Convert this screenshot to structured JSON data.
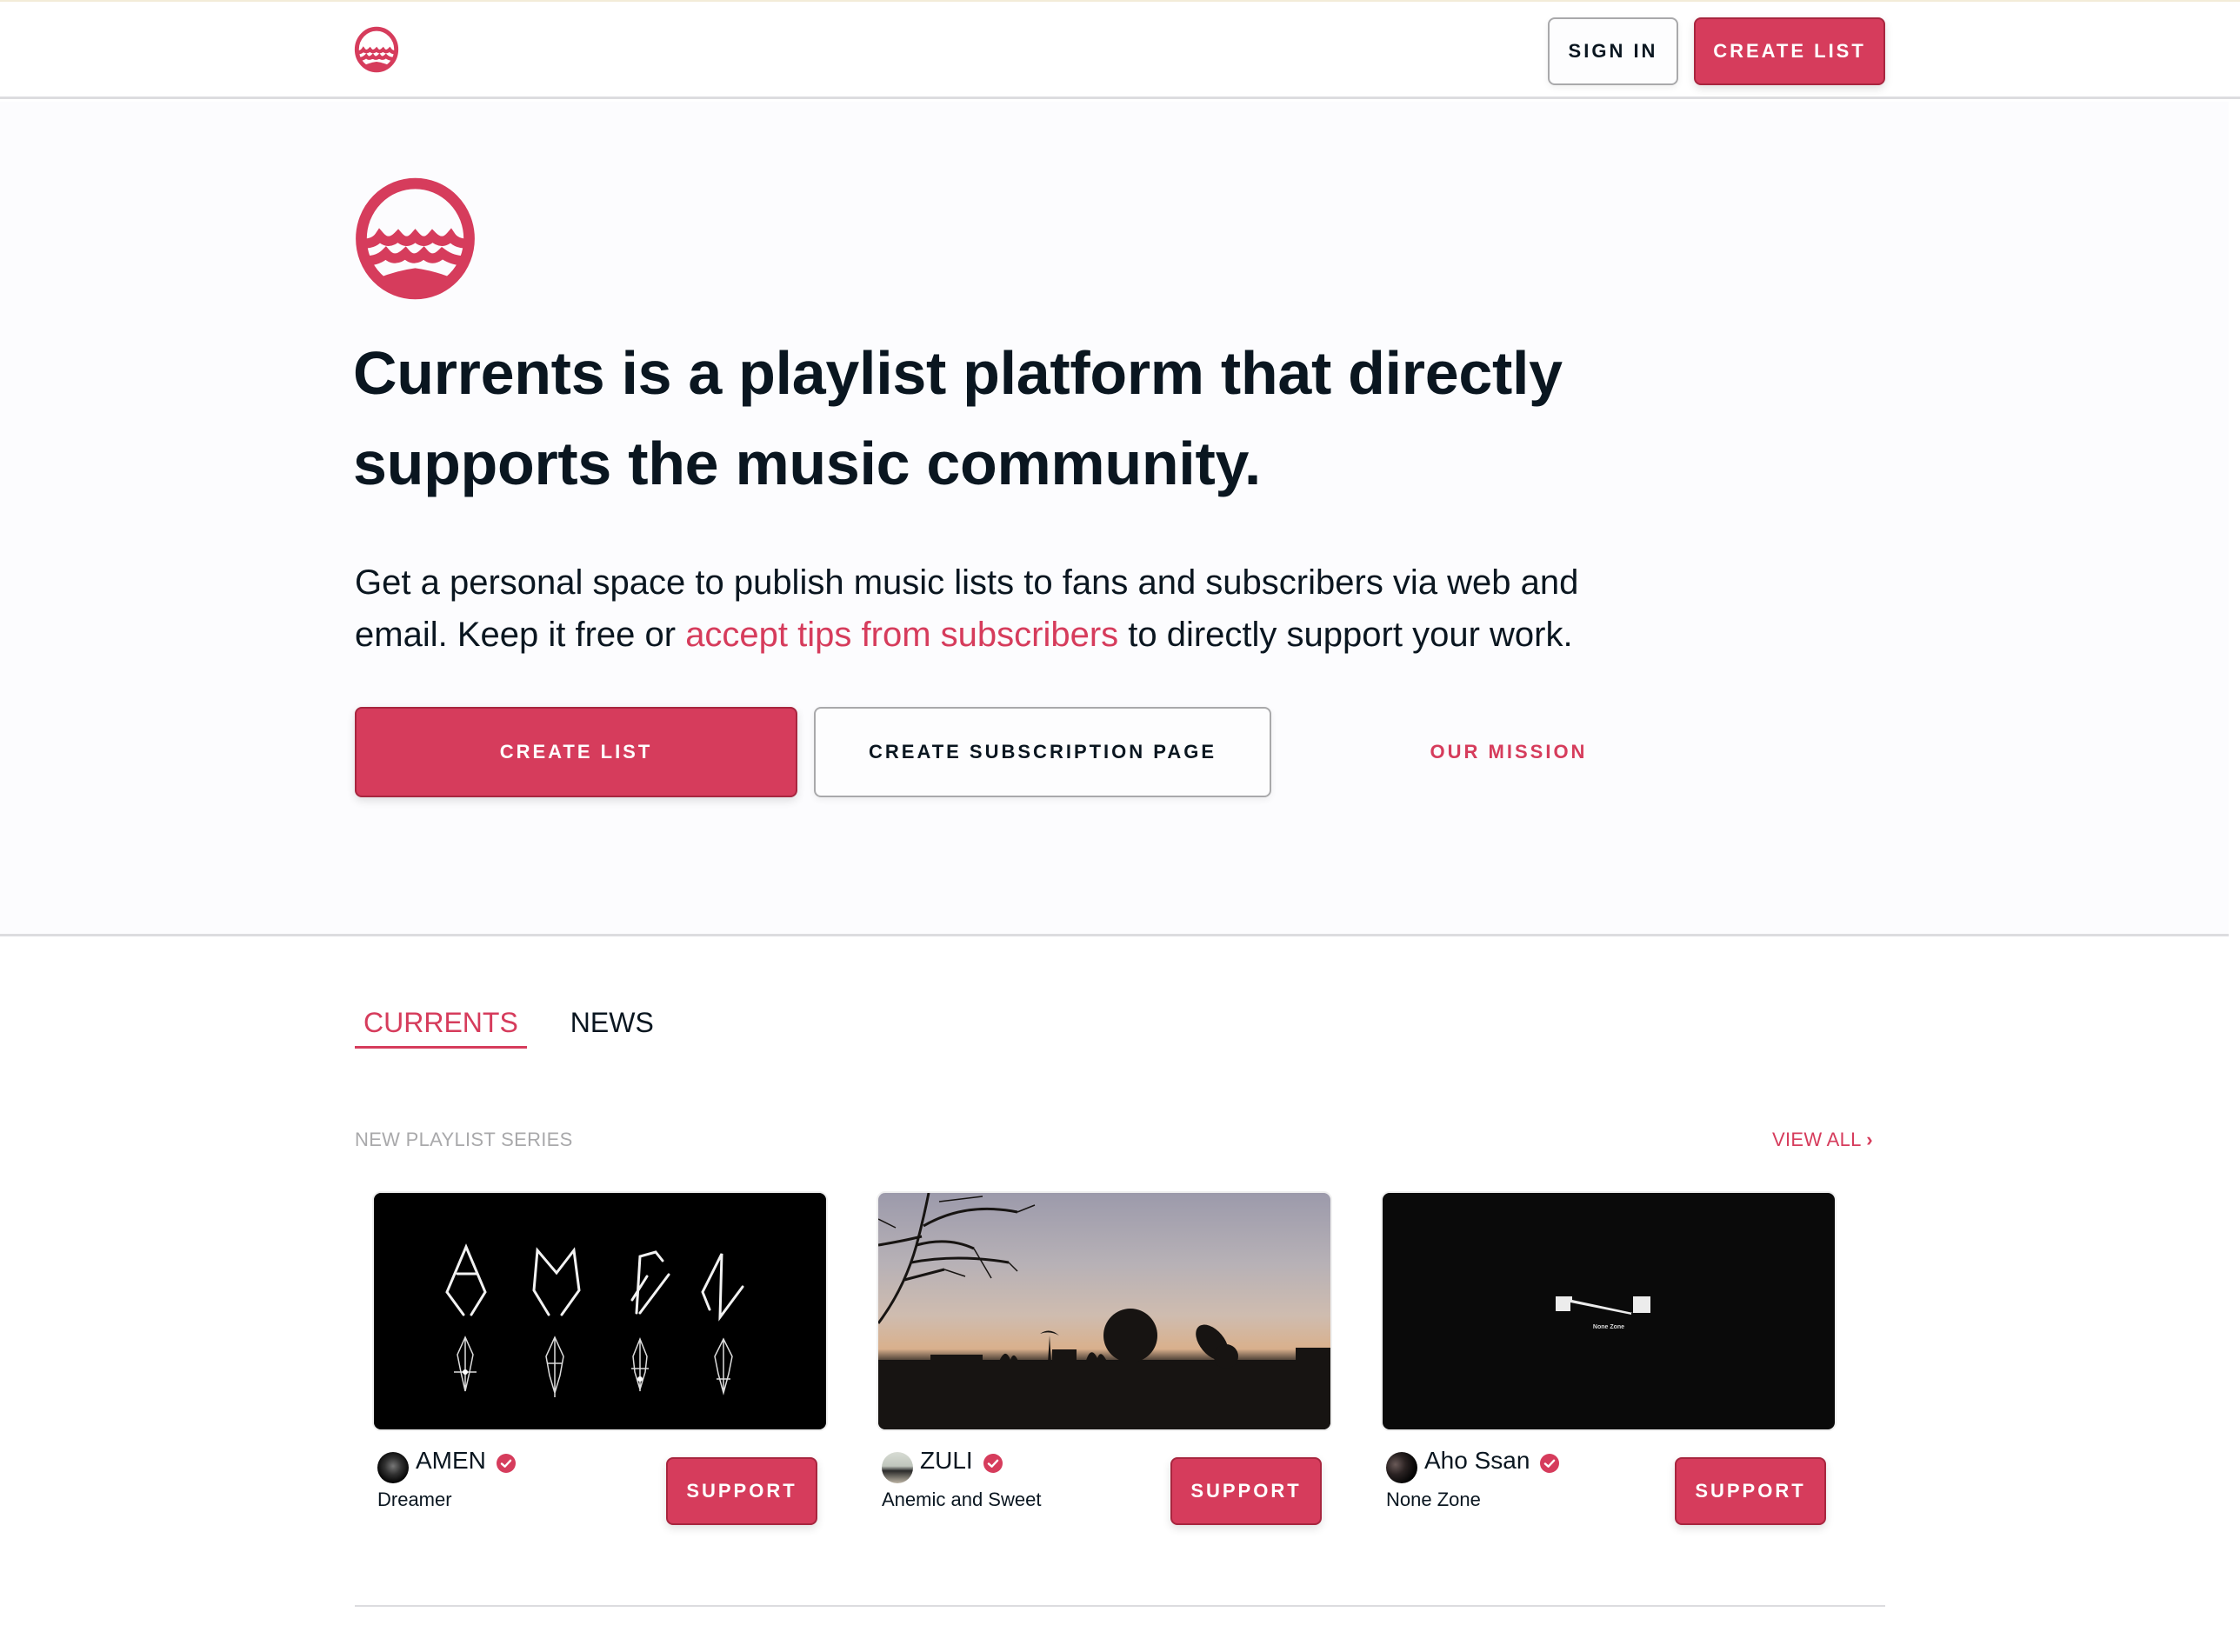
{
  "brand": {
    "name": "Currents",
    "logo_icon": "currents-wave-logo",
    "accent_color": "#d63c5c",
    "text_color": "#0a1620"
  },
  "header": {
    "sign_in_label": "SIGN IN",
    "create_list_label": "CREATE LIST"
  },
  "hero": {
    "headline": "Currents is a playlist platform that directly supports the music community.",
    "subcopy_before": "Get a personal space to publish music lists to fans and subscribers via web and email. Keep it free or ",
    "subcopy_link": "accept tips from subscribers",
    "subcopy_after": " to directly support your work.",
    "create_list_label": "CREATE LIST",
    "create_subscription_label": "CREATE SUBSCRIPTION PAGE",
    "our_mission_label": "OUR MISSION"
  },
  "tabs": [
    {
      "label": "CURRENTS",
      "active": true
    },
    {
      "label": "NEWS",
      "active": false
    }
  ],
  "section": {
    "label": "NEW PLAYLIST SERIES",
    "view_all_label": "VIEW ALL",
    "view_all_icon": "chevron-right-icon"
  },
  "cards": [
    {
      "artist": "AMEN",
      "verified": true,
      "series": "Dreamer",
      "support_label": "SUPPORT",
      "image": "amen-glyph-artwork"
    },
    {
      "artist": "ZULI",
      "verified": true,
      "series": "Anemic and Sweet",
      "support_label": "SUPPORT",
      "image": "sunset-satellite-dish-photo"
    },
    {
      "artist": "Aho Ssan",
      "verified": true,
      "series": "None Zone",
      "support_label": "SUPPORT",
      "image": "none-zone-cover",
      "image_caption": "None Zone"
    }
  ]
}
